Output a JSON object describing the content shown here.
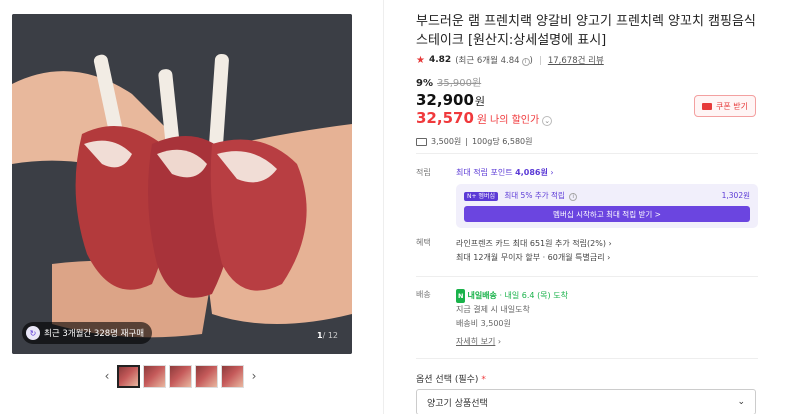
{
  "gallery": {
    "badge_text": "최근 3개월간 328명 재구매",
    "counter_current": "1",
    "counter_total": "/ 12",
    "prev_icon": "chevron-left-icon",
    "next_icon": "chevron-right-icon",
    "thumbnail_count": 5
  },
  "product": {
    "title": "부드러운 램 프렌치랙 양갈비 양고기 프렌치렉 양꼬치 캠핑음식 스테이크 [원산지:상세설명에 표시]",
    "rating": "4.82",
    "rating_recent": "(최근 6개월 4.84",
    "rating_recent_end": ")",
    "review_count": "17,678건 리뷰",
    "discount_rate": "9%",
    "original_price": "35,900원",
    "price": "32,900",
    "price_unit": "원",
    "my_price": "32,570",
    "my_price_unit": "원",
    "my_discount_label": "나의 할인가",
    "coupon_label": "쿠폰 받기",
    "shipping_fee": "3,500원",
    "unit_price": "100g당 6,580원"
  },
  "points": {
    "label": "적립",
    "max_points_prefix": "최대 적립 포인트 ",
    "max_points": "4,086원",
    "npay_badge": "N+ 멤버십",
    "extra_label": "최대 5% 추가 적립",
    "extra_amount": "1,302원",
    "membership_button": "멤버십 시작하고 최대 적립 받기 >"
  },
  "benefits": {
    "label": "혜택",
    "line1": "라인프렌즈 카드 최대 651원 추가 적립(2%)",
    "line2": "최대 12개월 무이자 할부 · 60개월 특별금리"
  },
  "delivery": {
    "label": "배송",
    "badge": "내일배송",
    "arrival": " · 내일 6.4 (목) 도착",
    "line2": "지금 결제 시 내일도착",
    "line3": "배송비 3,500원",
    "more_link": "자세히 보기"
  },
  "option": {
    "label": "옵션 선택 (필수)",
    "required_mark": "*",
    "selected": "양고기 상품선택"
  },
  "colors": {
    "accent_red": "#f0393c",
    "accent_purple": "#5b3ad6",
    "accent_green": "#19b24a"
  }
}
